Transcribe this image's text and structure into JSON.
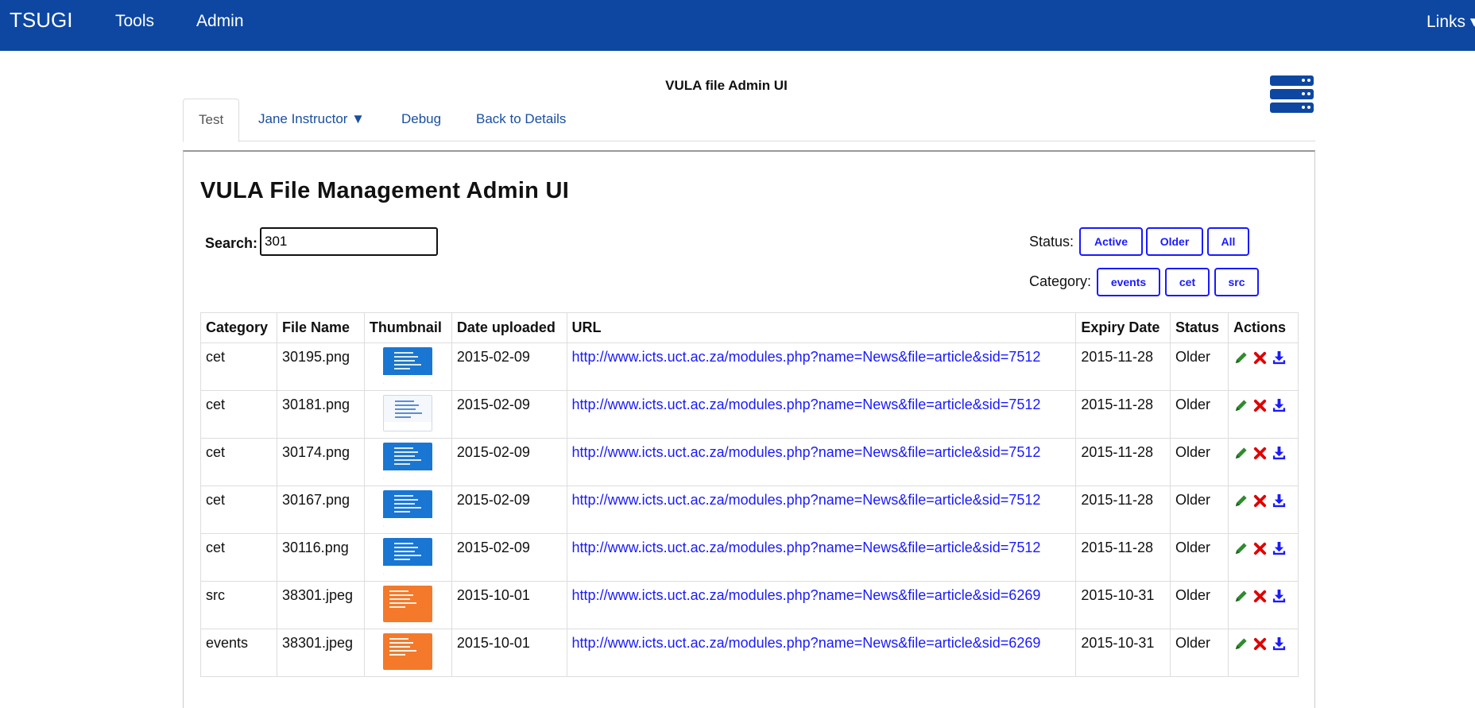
{
  "navbar": {
    "brand": "TSUGI",
    "items": [
      "Tools",
      "Admin"
    ],
    "right_link": "Links ▾"
  },
  "header": {
    "tool_title": "VULA file Admin UI"
  },
  "tabs": [
    "Test",
    "Jane Instructor ▼",
    "Debug",
    "Back to Details"
  ],
  "main": {
    "heading": "VULA File Management Admin UI",
    "search_label": "Search:",
    "search_value": "301",
    "status_label": "Status:",
    "status_buttons": [
      "Active",
      "Older",
      "All"
    ],
    "category_label": "Category:",
    "category_buttons": [
      "events",
      "cet",
      "src"
    ]
  },
  "table": {
    "headers": [
      "Category",
      "File Name",
      "Thumbnail",
      "Date uploaded",
      "URL",
      "Expiry Date",
      "Status",
      "Actions"
    ],
    "rows": [
      {
        "category": "cet",
        "file_name": "30195.png",
        "thumb_style": "blue",
        "date_uploaded": "2015-02-09",
        "url": "http://www.icts.uct.ac.za/modules.php?name=News&file=article&sid=7512",
        "expiry": "2015-11-28",
        "status": "Older"
      },
      {
        "category": "cet",
        "file_name": "30181.png",
        "thumb_style": "white",
        "date_uploaded": "2015-02-09",
        "url": "http://www.icts.uct.ac.za/modules.php?name=News&file=article&sid=7512",
        "expiry": "2015-11-28",
        "status": "Older"
      },
      {
        "category": "cet",
        "file_name": "30174.png",
        "thumb_style": "blue",
        "date_uploaded": "2015-02-09",
        "url": "http://www.icts.uct.ac.za/modules.php?name=News&file=article&sid=7512",
        "expiry": "2015-11-28",
        "status": "Older"
      },
      {
        "category": "cet",
        "file_name": "30167.png",
        "thumb_style": "blue",
        "date_uploaded": "2015-02-09",
        "url": "http://www.icts.uct.ac.za/modules.php?name=News&file=article&sid=7512",
        "expiry": "2015-11-28",
        "status": "Older"
      },
      {
        "category": "cet",
        "file_name": "30116.png",
        "thumb_style": "blue",
        "date_uploaded": "2015-02-09",
        "url": "http://www.icts.uct.ac.za/modules.php?name=News&file=article&sid=7512",
        "expiry": "2015-11-28",
        "status": "Older"
      },
      {
        "category": "src",
        "file_name": "38301.jpeg",
        "thumb_style": "orange",
        "date_uploaded": "2015-10-01",
        "url": "http://www.icts.uct.ac.za/modules.php?name=News&file=article&sid=6269",
        "expiry": "2015-10-31",
        "status": "Older"
      },
      {
        "category": "events",
        "file_name": "38301.jpeg",
        "thumb_style": "orange",
        "date_uploaded": "2015-10-01",
        "url": "http://www.icts.uct.ac.za/modules.php?name=News&file=article&sid=6269",
        "expiry": "2015-10-31",
        "status": "Older"
      }
    ],
    "action_icons": [
      "pencil-icon",
      "delete-x-icon",
      "download-icon"
    ]
  },
  "colors": {
    "navbar_bg": "#0d47a1",
    "link": "#1a1aff",
    "tab_link": "#1a4fa0",
    "edit_icon": "#2e8b2e",
    "delete_icon": "#e00000",
    "download_icon": "#1a1aff"
  }
}
